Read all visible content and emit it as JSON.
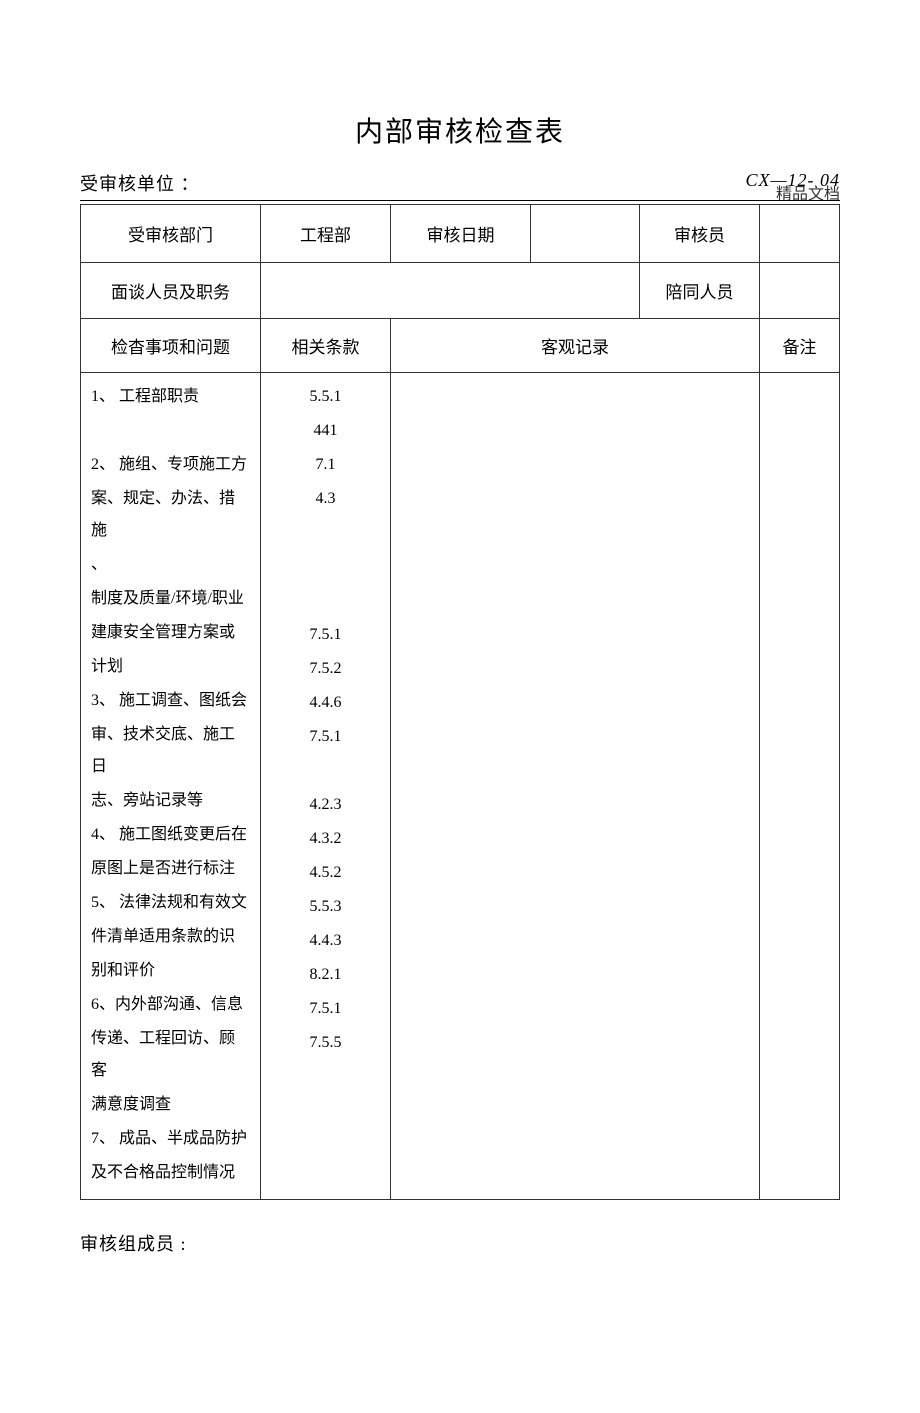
{
  "header_label": "精品文档",
  "title": "内部审核检查表",
  "info": {
    "unit_label": "受审核单位 ：",
    "doc_code": "CX—12- 04"
  },
  "row1": {
    "dept_label": "受审核部门",
    "dept_value": "工程部",
    "date_label": "审核日期",
    "auditor_label": "审核员"
  },
  "row2": {
    "interview_label": "面谈人员及职务",
    "accompany_label": "陪同人员"
  },
  "row3": {
    "check_label": "检杳事项和问题",
    "clause_label": "相关条款",
    "record_label": "客观记录",
    "remark_label": "备注"
  },
  "checklist": [
    "1、 工程部职责",
    "",
    "2、 施组、专项施工方",
    "案、规定、办法、措施",
    "、",
    "制度及质量/环境/职业",
    "建康安全管理方案或",
    "计划",
    "3、 施工调查、图纸会",
    "审、技术交底、施工日",
    "志、旁站记录等",
    "4、 施工图纸变更后在",
    "原图上是否进行标注",
    "5、 法律法规和有效文",
    "件清单适用条款的识",
    "别和评价",
    "6、内外部沟通、信息",
    "传递、工程回访、顾客",
    "满意度调查",
    "7、 成品、半成品防护",
    "及不合格品控制情况"
  ],
  "clauses": [
    "5.5.1",
    "441",
    "7.1",
    "4.3",
    "",
    "",
    "",
    "7.5.1",
    "7.5.2",
    "4.4.6",
    "7.5.1",
    "",
    "4.2.3",
    "4.3.2",
    "4.5.2",
    "5.5.3",
    "4.4.3",
    "8.2.1",
    "7.5.1",
    "7.5.5",
    ""
  ],
  "footer": "审核组成员 :"
}
